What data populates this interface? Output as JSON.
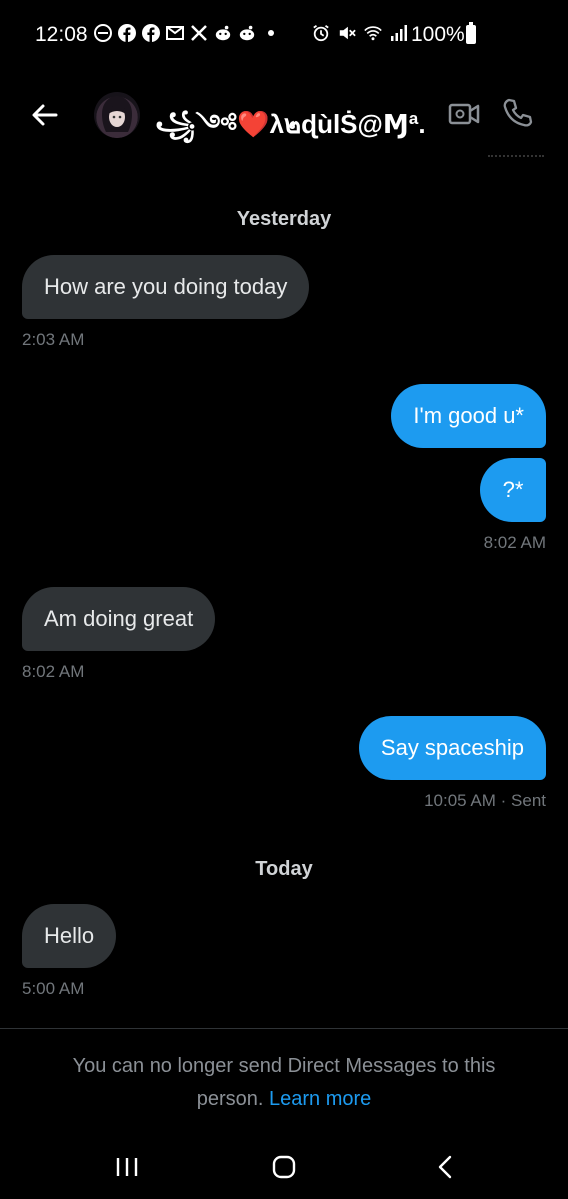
{
  "status_bar": {
    "time": "12:08",
    "battery_percent": "100%",
    "left_icons": [
      "do-not-disturb-icon",
      "facebook-icon",
      "facebook-icon",
      "email-icon",
      "x-icon",
      "reddit-icon",
      "reddit-icon",
      "dot-icon"
    ],
    "right_icons": [
      "alarm-icon",
      "mute-icon",
      "wifi-icon",
      "signal-icon",
      "battery-icon"
    ]
  },
  "header": {
    "contact_name": "꧁༺❤️λ๒ɖùlṠ@Ɱª...",
    "icons": [
      "back-arrow-icon",
      "avatar",
      "video-call-icon",
      "phone-icon"
    ]
  },
  "conversation": {
    "date_yesterday": "Yesterday",
    "date_today": "Today",
    "messages": [
      {
        "direction": "in",
        "text": "How are you doing today",
        "meta": "2:03 AM"
      },
      {
        "direction": "out",
        "text": "I'm good u*",
        "meta": ""
      },
      {
        "direction": "out",
        "text": "?*",
        "meta": "8:02 AM"
      },
      {
        "direction": "in",
        "text": "Am doing great",
        "meta": "8:02 AM"
      },
      {
        "direction": "out",
        "text": "Say spaceship",
        "meta": "10:05 AM · Sent"
      },
      {
        "direction": "in",
        "text": "Hello",
        "meta": "5:00 AM"
      }
    ]
  },
  "footer": {
    "notice": "You can no longer send Direct Messages to this person.",
    "learn_more": "Learn more"
  },
  "colors": {
    "accent": "#1d9bf0",
    "incoming_bubble": "#2f3336",
    "background": "#000000",
    "meta_text": "#71767b"
  }
}
